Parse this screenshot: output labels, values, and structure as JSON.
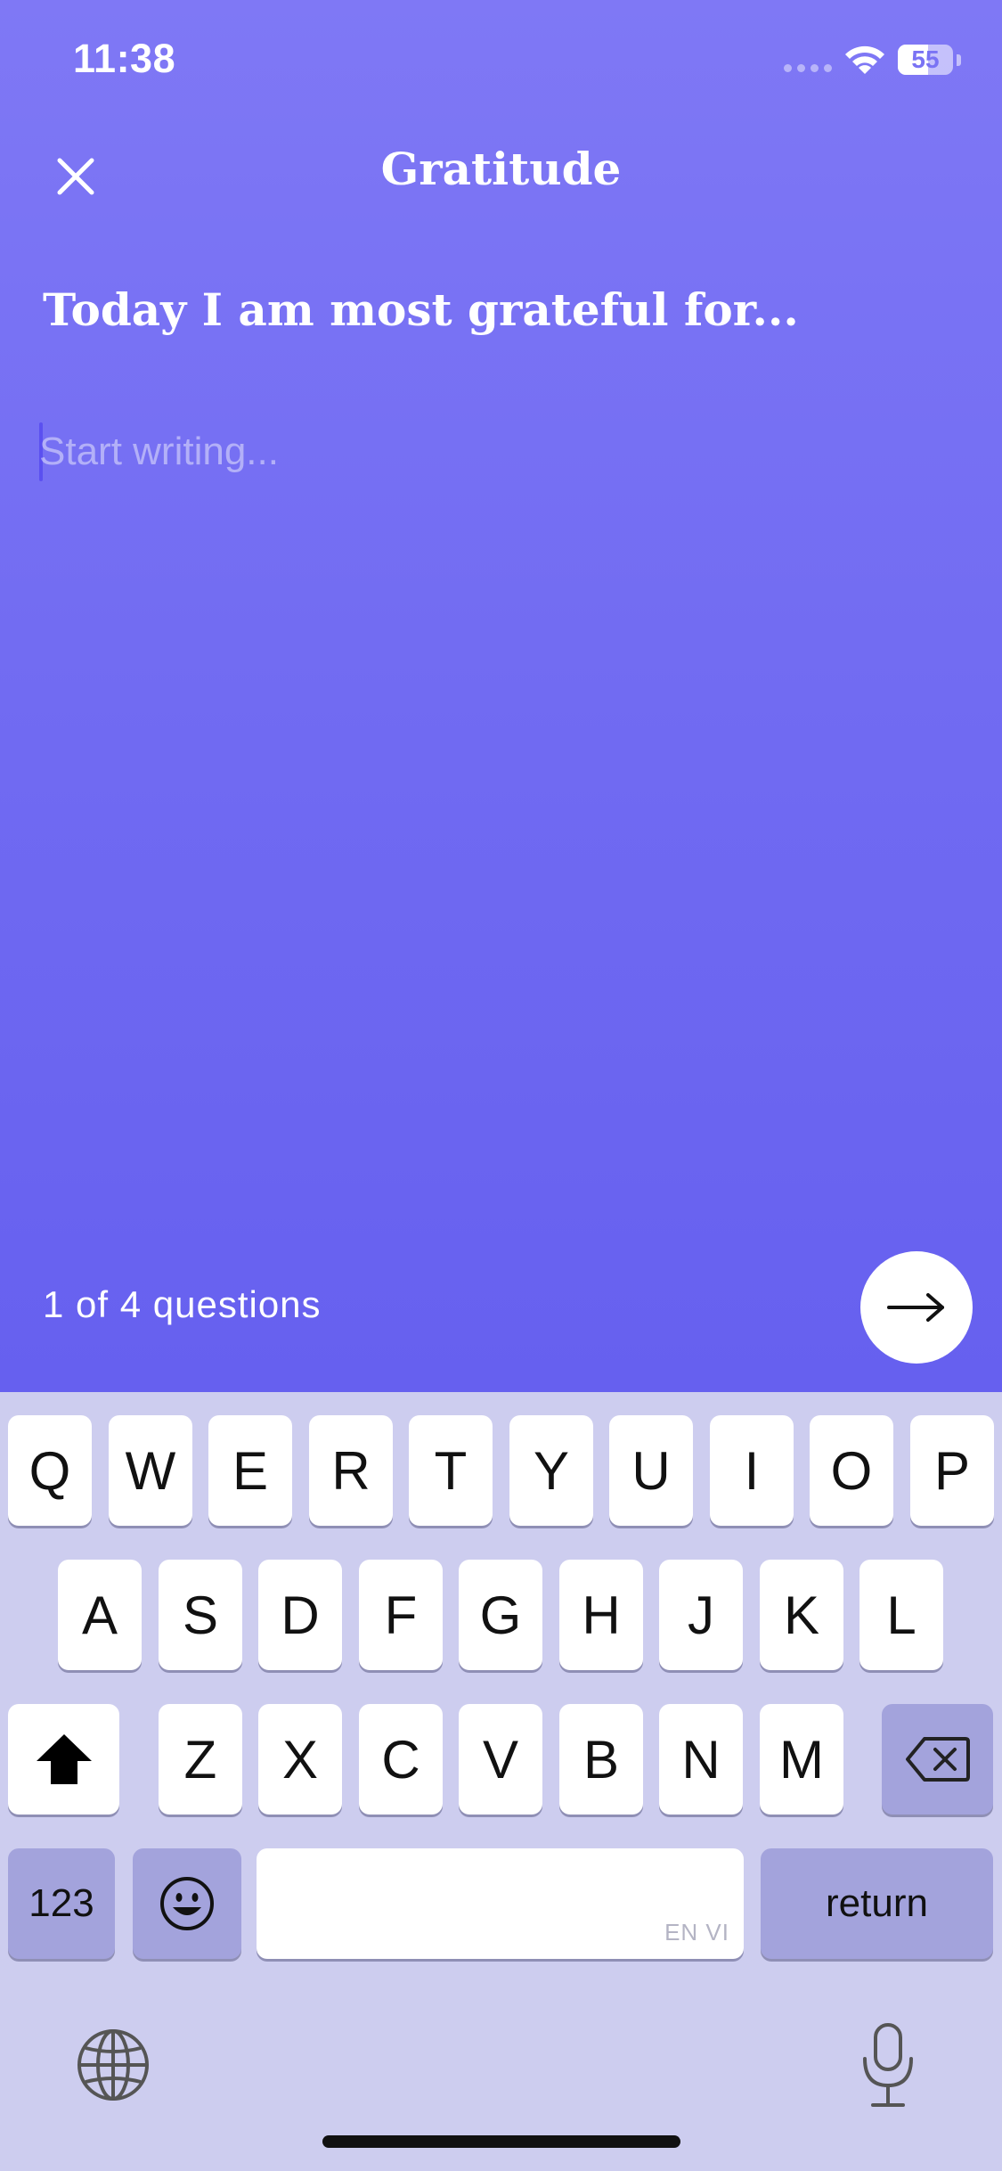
{
  "status_bar": {
    "time": "11:38",
    "battery": "55",
    "battery_level": 0.55
  },
  "header": {
    "title": "Gratitude",
    "close_icon": "close-icon"
  },
  "prompt": {
    "question": "Today I am most grateful for..."
  },
  "editor": {
    "placeholder": "Start writing...",
    "value": ""
  },
  "footer": {
    "progress_text": "1 of 4 questions",
    "next_icon": "arrow-right-icon"
  },
  "keyboard": {
    "row1": [
      "Q",
      "W",
      "E",
      "R",
      "T",
      "Y",
      "U",
      "I",
      "O",
      "P"
    ],
    "row2": [
      "A",
      "S",
      "D",
      "F",
      "G",
      "H",
      "J",
      "K",
      "L"
    ],
    "row3": [
      "Z",
      "X",
      "C",
      "V",
      "B",
      "N",
      "M"
    ],
    "numbers_label": "123",
    "return_label": "return",
    "space_hint": "EN VI"
  },
  "colors": {
    "background_top": "#7f78f5",
    "background_bottom": "#6660ef",
    "keyboard_bg": "#cdcdef",
    "function_key": "#a3a3dc"
  }
}
